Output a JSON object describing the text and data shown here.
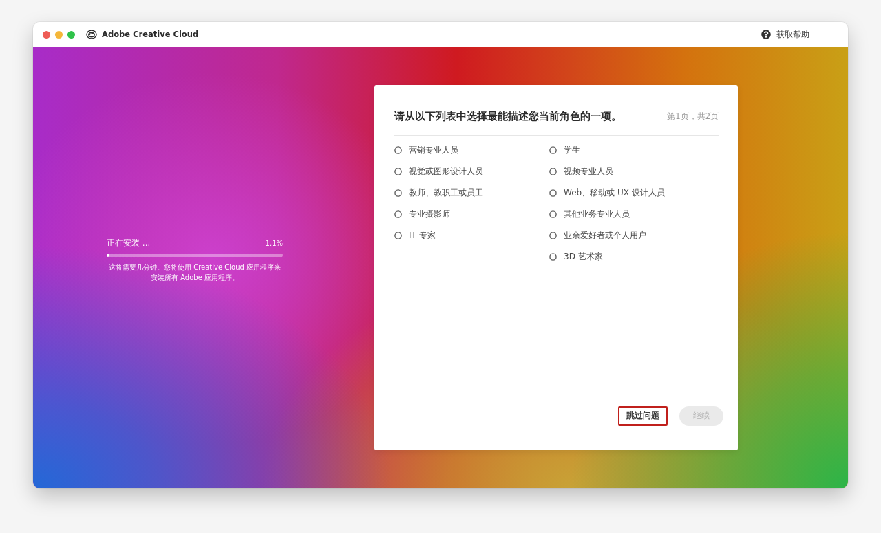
{
  "window": {
    "title": "Adobe Creative Cloud",
    "help_link": "获取帮助"
  },
  "install": {
    "status": "正在安装 ...",
    "percent": "1.1%",
    "level": 0.011,
    "description": "这将需要几分钟。您将使用 Creative Cloud 应用程序来安装所有 Adobe 应用程序。"
  },
  "survey": {
    "question": "请从以下列表中选择最能描述您当前角色的一项。",
    "page": "第1页，共2页",
    "columns": [
      {
        "options": [
          {
            "label": "营销专业人员",
            "selected": false
          },
          {
            "label": "视觉或图形设计人员",
            "selected": false
          },
          {
            "label": "教师、教职工或员工",
            "selected": false
          },
          {
            "label": "专业摄影师",
            "selected": false
          },
          {
            "label": "IT 专家",
            "selected": false
          }
        ]
      },
      {
        "options": [
          {
            "label": "学生",
            "selected": false
          },
          {
            "label": "视频专业人员",
            "selected": false
          },
          {
            "label": "Web、移动或 UX 设计人员",
            "selected": false
          },
          {
            "label": "其他业务专业人员",
            "selected": false
          },
          {
            "label": "业余爱好者或个人用户",
            "selected": false
          },
          {
            "label": "3D 艺术家",
            "selected": false
          }
        ]
      }
    ],
    "buttons": [
      {
        "label": "跳过问题",
        "kind": "secondary",
        "disabled": false,
        "highlighted": true
      },
      {
        "label": "继续",
        "kind": "primary",
        "disabled": true,
        "highlighted": false
      }
    ]
  }
}
